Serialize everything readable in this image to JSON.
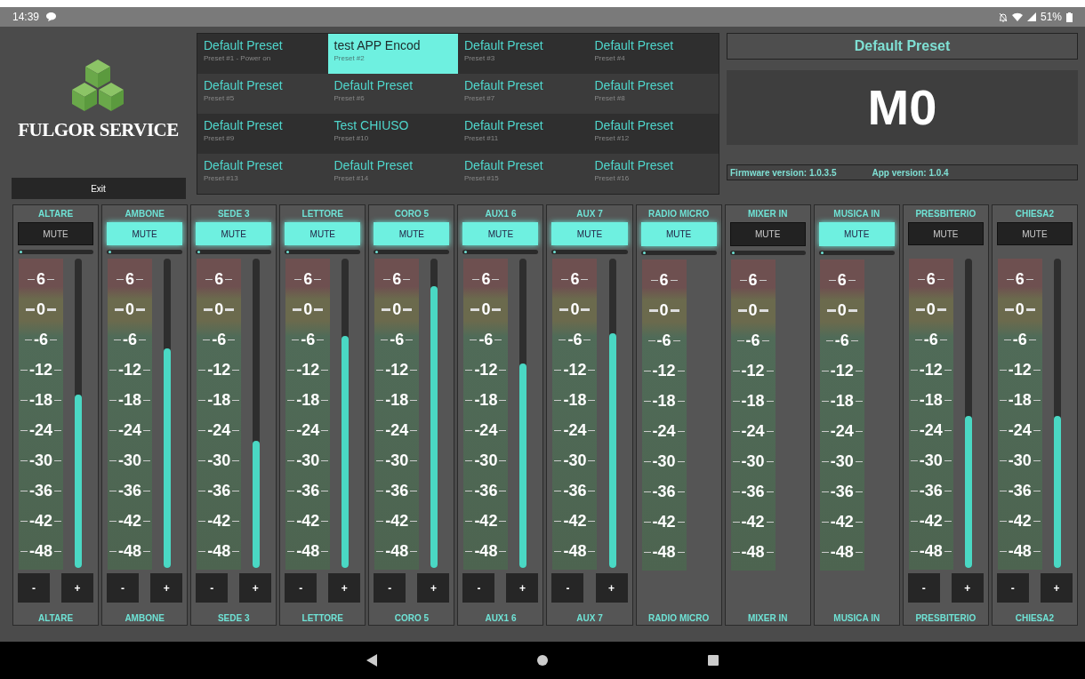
{
  "status_bar": {
    "time": "14:39",
    "battery": "51%"
  },
  "logo": {
    "text": "FULGOR SERVICE"
  },
  "exit_button": "Exit",
  "presets": [
    {
      "title": "Default Preset",
      "subtitle": "Preset #1 - Power on",
      "selected": false
    },
    {
      "title": "test APP Encod",
      "subtitle": "Preset #2",
      "selected": true
    },
    {
      "title": "Default Preset",
      "subtitle": "Preset #3",
      "selected": false
    },
    {
      "title": "Default Preset",
      "subtitle": "Preset #4",
      "selected": false
    },
    {
      "title": "Default Preset",
      "subtitle": "Preset #5",
      "selected": false
    },
    {
      "title": "Default Preset",
      "subtitle": "Preset #6",
      "selected": false
    },
    {
      "title": "Default Preset",
      "subtitle": "Preset #7",
      "selected": false
    },
    {
      "title": "Default Preset",
      "subtitle": "Preset #8",
      "selected": false
    },
    {
      "title": "Default Preset",
      "subtitle": "Preset #9",
      "selected": false
    },
    {
      "title": "Test CHIUSO",
      "subtitle": "Preset #10",
      "selected": false
    },
    {
      "title": "Default Preset",
      "subtitle": "Preset #11",
      "selected": false
    },
    {
      "title": "Default Preset",
      "subtitle": "Preset #12",
      "selected": false
    },
    {
      "title": "Default Preset",
      "subtitle": "Preset #13",
      "selected": false
    },
    {
      "title": "Default Preset",
      "subtitle": "Preset #14",
      "selected": false
    },
    {
      "title": "Default Preset",
      "subtitle": "Preset #15",
      "selected": false
    },
    {
      "title": "Default Preset",
      "subtitle": "Preset #16",
      "selected": false
    }
  ],
  "current_preset": "Default Preset",
  "device_label": "M0",
  "firmware": "Firmware version: 1.0.3.5",
  "app_version": "App version: 1.0.4",
  "channels": [
    {
      "name": "ALTARE",
      "kind": "input",
      "muted": false,
      "mute_label": "MUTE",
      "level": 0.56,
      "scale": [
        "6",
        "0",
        "-6",
        "-12",
        "-18",
        "-24",
        "-30",
        "-36",
        "-42",
        "-48"
      ],
      "minus": "-",
      "plus": "+",
      "footer": "ALTARE"
    },
    {
      "name": "AMBONE",
      "kind": "input",
      "muted": true,
      "mute_label": "MUTE",
      "level": 0.71,
      "scale": [
        "6",
        "0",
        "-6",
        "-12",
        "-18",
        "-24",
        "-30",
        "-36",
        "-42",
        "-48"
      ],
      "minus": "-",
      "plus": "+",
      "footer": "AMBONE"
    },
    {
      "name": "SEDE 3",
      "kind": "input",
      "muted": true,
      "mute_label": "MUTE",
      "level": 0.41,
      "scale": [
        "6",
        "0",
        "-6",
        "-12",
        "-18",
        "-24",
        "-30",
        "-36",
        "-42",
        "-48"
      ],
      "minus": "-",
      "plus": "+",
      "footer": "SEDE 3"
    },
    {
      "name": "LETTORE",
      "kind": "input",
      "muted": true,
      "mute_label": "MUTE",
      "level": 0.75,
      "scale": [
        "6",
        "0",
        "-6",
        "-12",
        "-18",
        "-24",
        "-30",
        "-36",
        "-42",
        "-48"
      ],
      "minus": "-",
      "plus": "+",
      "footer": "LETTORE"
    },
    {
      "name": "CORO 5",
      "kind": "input",
      "muted": true,
      "mute_label": "MUTE",
      "level": 0.91,
      "scale": [
        "6",
        "0",
        "-6",
        "-12",
        "-18",
        "-24",
        "-30",
        "-36",
        "-42",
        "-48"
      ],
      "minus": "-",
      "plus": "+",
      "footer": "CORO 5"
    },
    {
      "name": "AUX1 6",
      "kind": "input",
      "muted": true,
      "mute_label": "MUTE",
      "level": 0.66,
      "scale": [
        "6",
        "0",
        "-6",
        "-12",
        "-18",
        "-24",
        "-30",
        "-36",
        "-42",
        "-48"
      ],
      "minus": "-",
      "plus": "+",
      "footer": "AUX1 6"
    },
    {
      "name": "AUX 7",
      "kind": "input",
      "muted": true,
      "mute_label": "MUTE",
      "level": 0.76,
      "scale": [
        "6",
        "0",
        "-6",
        "-12",
        "-18",
        "-24",
        "-30",
        "-36",
        "-42",
        "-48"
      ],
      "minus": "-",
      "plus": "+",
      "footer": "AUX 7"
    },
    {
      "name": "RADIO MICRO",
      "kind": "monitor",
      "muted": true,
      "mute_label": "MUTE",
      "scale": [
        "6",
        "0",
        "-6",
        "-12",
        "-18",
        "-24",
        "-30",
        "-36",
        "-42",
        "-48"
      ],
      "footer": "RADIO MICRO"
    },
    {
      "name": "MIXER IN",
      "kind": "monitor",
      "muted": false,
      "mute_label": "MUTE",
      "scale": [
        "6",
        "0",
        "-6",
        "-12",
        "-18",
        "-24",
        "-30",
        "-36",
        "-42",
        "-48"
      ],
      "footer": "MIXER IN"
    },
    {
      "name": "MUSICA IN",
      "kind": "monitor",
      "muted": true,
      "mute_label": "MUTE",
      "scale": [
        "6",
        "0",
        "-6",
        "-12",
        "-18",
        "-24",
        "-30",
        "-36",
        "-42",
        "-48"
      ],
      "footer": "MUSICA IN"
    },
    {
      "name": "PRESBITERIO",
      "kind": "output",
      "muted": false,
      "mute_label": "MUTE",
      "level": 0.49,
      "scale": [
        "6",
        "0",
        "-6",
        "-12",
        "-18",
        "-24",
        "-30",
        "-36",
        "-42",
        "-48"
      ],
      "minus": "-",
      "plus": "+",
      "footer": "PRESBITERIO"
    },
    {
      "name": "CHIESA2",
      "kind": "output",
      "muted": false,
      "mute_label": "MUTE",
      "level": 0.49,
      "scale": [
        "6",
        "0",
        "-6",
        "-12",
        "-18",
        "-24",
        "-30",
        "-36",
        "-42",
        "-48"
      ],
      "minus": "-",
      "plus": "+",
      "footer": "CHIESA2"
    }
  ]
}
